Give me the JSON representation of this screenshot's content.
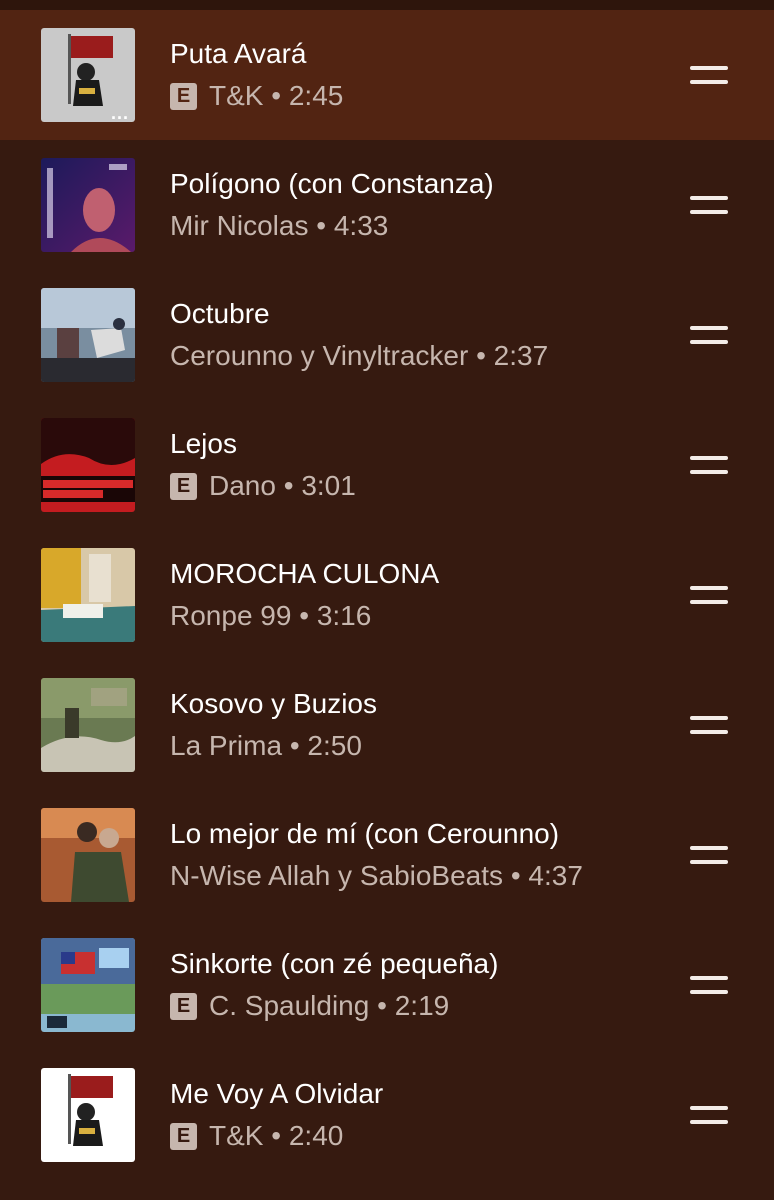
{
  "colors": {
    "background": "#361a10",
    "active_row": "#522412",
    "title_text": "#ffffff",
    "subtitle_text": "#c6b6ae"
  },
  "tracks": [
    {
      "title": "Puta Avará",
      "artist": "T&K",
      "duration": "2:45",
      "explicit": "E",
      "active": true,
      "art": "tk-bear-cover",
      "more_label": "..."
    },
    {
      "title": "Polígono (con Constanza)",
      "artist": "Mir Nicolas",
      "duration": "4:33",
      "art": "mir-nicolas-cover"
    },
    {
      "title": "Octubre",
      "artist": "Cerounno y Vinyltracker",
      "duration": "2:37",
      "art": "octubre-cover"
    },
    {
      "title": "Lejos",
      "artist": "Dano",
      "duration": "3:01",
      "explicit": "E",
      "art": "istmo-dano-cover"
    },
    {
      "title": "MOROCHA CULONA",
      "artist": "Ronpe 99",
      "duration": "3:16",
      "art": "ronpe-cover"
    },
    {
      "title": "Kosovo y Buzios",
      "artist": "La Prima",
      "duration": "2:50",
      "art": "la-prima-cover"
    },
    {
      "title": "Lo mejor de mí (con Cerounno)",
      "artist": "N-Wise Allah y SabioBeats",
      "duration": "4:37",
      "art": "n-wise-cover"
    },
    {
      "title": "Sinkorte (con zé pequeña)",
      "artist": "C. Spaulding",
      "duration": "2:19",
      "explicit": "E",
      "art": "spaulding-cover"
    },
    {
      "title": "Me Voy A Olvidar",
      "artist": "T&K",
      "duration": "2:40",
      "explicit": "E",
      "art": "tk-bear-cover-white"
    }
  ],
  "separator": "•",
  "drag_handle_icon": "drag-handle-icon"
}
